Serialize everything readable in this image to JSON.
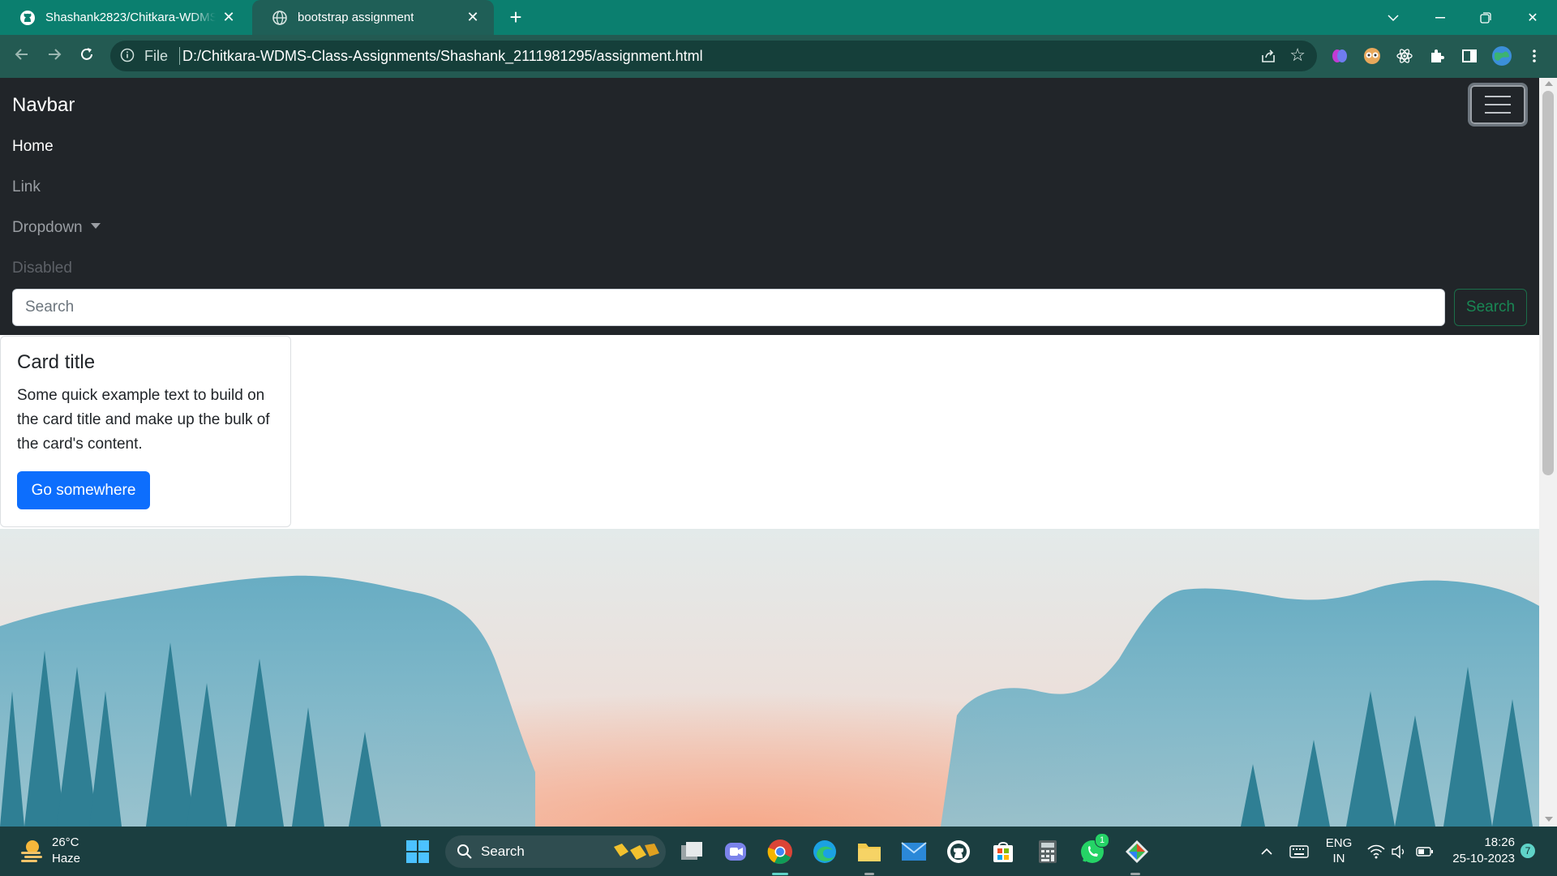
{
  "browser": {
    "tabs": [
      {
        "label": "Shashank2823/Chitkara-WDMS-",
        "icon": "github-icon",
        "active": false
      },
      {
        "label": "bootstrap assignment",
        "icon": "globe-icon",
        "active": true
      }
    ],
    "address": {
      "scheme_label": "File",
      "url": "D:/Chitkara-WDMS-Class-Assignments/Shashank_2111981295/assignment.html"
    }
  },
  "page": {
    "navbar": {
      "brand": "Navbar",
      "links": [
        "Home",
        "Link",
        "Dropdown",
        "Disabled"
      ],
      "search_placeholder": "Search",
      "search_button": "Search"
    },
    "card": {
      "title": "Card title",
      "text": "Some quick example text to build on the card title and make up the bulk of the card's content.",
      "button": "Go somewhere"
    }
  },
  "taskbar": {
    "weather_temp": "26°C",
    "weather_condition": "Haze",
    "search_label": "Search",
    "lang_line1": "ENG",
    "lang_line2": "IN",
    "time": "18:26",
    "date": "25-10-2023",
    "notification_count": "7",
    "whatsapp_badge": "1"
  },
  "colors": {
    "tabstrip": "#0b7f6f",
    "navbar_bg": "#212529",
    "primary": "#0d6efd",
    "success": "#198754",
    "taskbar": "#1b3e40"
  }
}
